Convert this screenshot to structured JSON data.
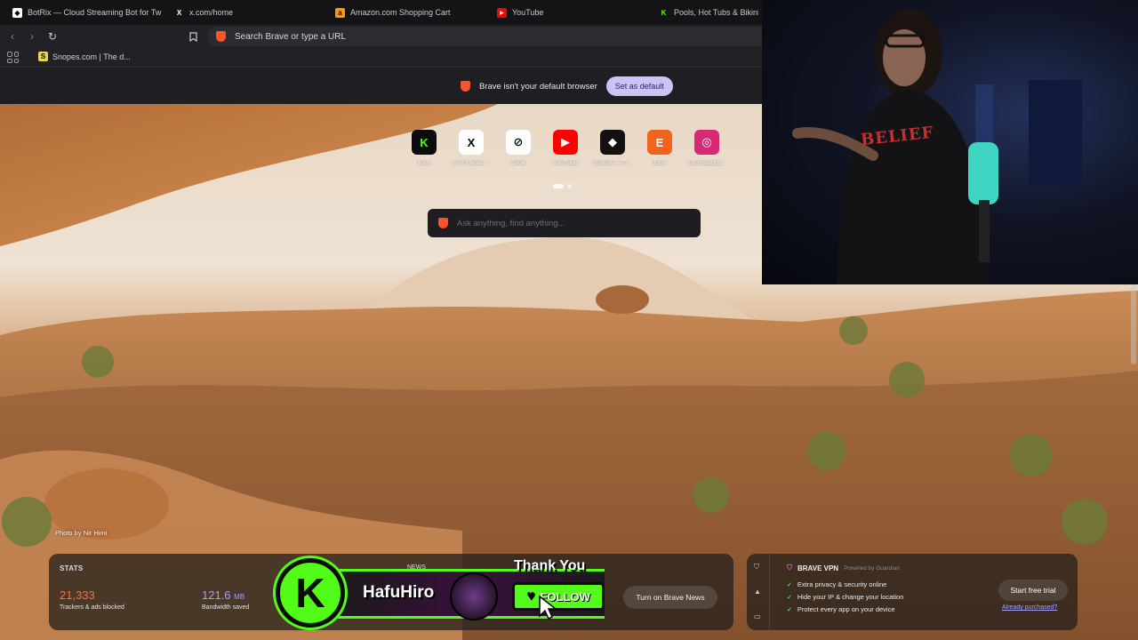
{
  "tabs": [
    {
      "title": "BotRix — Cloud Streaming Bot for Tw",
      "icon": "botrix-icon",
      "color": "#ffffff"
    },
    {
      "title": "x.com/home",
      "icon": "x-icon",
      "color": "#ffffff"
    },
    {
      "title": "Amazon.com Shopping Cart",
      "icon": "amazon-icon",
      "color": "#ff9900"
    },
    {
      "title": "YouTube",
      "icon": "youtube-icon",
      "color": "#ff0000"
    },
    {
      "title": "Pools, Hot Tubs & Bikinis",
      "icon": "kick-icon",
      "color": "#53fc18"
    }
  ],
  "toolbar": {
    "url_placeholder": "Search Brave or type a URL"
  },
  "bookmarks": [
    {
      "label": "Snopes.com | The d..."
    }
  ],
  "banner": {
    "text": "Brave isn't your default browser",
    "button": "Set as default"
  },
  "top_sites": [
    {
      "label": "Kick",
      "glyph": "K",
      "color": "#53fc18",
      "bg": "#0c0c0c"
    },
    {
      "label": "X. It's what ...",
      "glyph": "X",
      "color": "#000000",
      "bg": "#ffffff"
    },
    {
      "label": "Grok",
      "glyph": "⊘",
      "color": "#000000",
      "bg": "#ffffff"
    },
    {
      "label": "YouTube",
      "glyph": "▶",
      "color": "#ffffff",
      "bg": "#ff0000"
    },
    {
      "label": "BotRix — C...",
      "glyph": "◆",
      "color": "#ffffff",
      "bg": "#111111"
    },
    {
      "label": "Etsy",
      "glyph": "E",
      "color": "#ffffff",
      "bg": "#f1641e"
    },
    {
      "label": "(3) Instagra...",
      "glyph": "◎",
      "color": "#ffffff",
      "bg": "#d62976"
    }
  ],
  "search": {
    "placeholder": "Ask anything, find anything..."
  },
  "photo_credit": "Photo by Nir Himi",
  "stats": {
    "title": "STATS",
    "trackers_value": "21,333",
    "trackers_label": "Trackers & ads blocked",
    "bandwidth_value": "121.6",
    "bandwidth_unit": "MB",
    "bandwidth_label": "Bandwidth saved",
    "news_label": "NEWS",
    "news_button": "Turn on Brave News"
  },
  "vpn": {
    "title": "BRAVE VPN",
    "powered": "Powered by Guardian",
    "features": [
      "Extra privacy & security online",
      "Hide your IP & change your location",
      "Protect every app on your device"
    ],
    "button": "Start free trial",
    "link": "Already purchased?"
  },
  "overlay": {
    "thank_you": "Thank You",
    "name": "HafuHiro",
    "follow": "FOLLOW",
    "kick_glyph": "K"
  },
  "webcam": {
    "shirt_text": "BELIEF"
  },
  "colors": {
    "brave": "#fb542b",
    "kick": "#53fc18",
    "stats_orange": "#ff6b3d",
    "stats_purple": "#a9a0ff"
  }
}
